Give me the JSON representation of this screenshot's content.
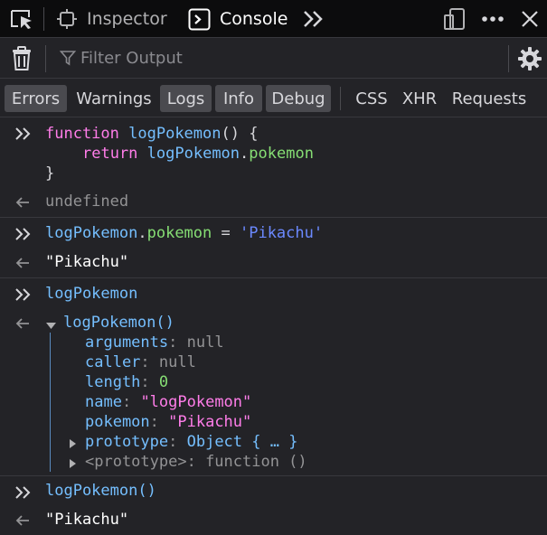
{
  "toolbar": {
    "tabs": [
      {
        "icon": "picker-icon"
      },
      {
        "label": "Inspector",
        "icon": "inspector-icon"
      },
      {
        "label": "Console",
        "icon": "console-icon"
      }
    ],
    "more_tools_icon": "double-chevron-icon",
    "right_icons": [
      "responsive-design-icon",
      "meatball-menu-icon",
      "close-icon"
    ]
  },
  "filter": {
    "placeholder": "Filter Output",
    "trash_icon": "trash-icon",
    "settings_icon": "gear-icon"
  },
  "categories": [
    {
      "label": "Errors",
      "active": true
    },
    {
      "label": "Warnings",
      "active": false
    },
    {
      "label": "Logs",
      "active": true
    },
    {
      "label": "Info",
      "active": true
    },
    {
      "label": "Debug",
      "active": true
    },
    {
      "label": "CSS",
      "active": false
    },
    {
      "label": "XHR",
      "active": false
    },
    {
      "label": "Requests",
      "active": false
    }
  ],
  "console": {
    "entry1": {
      "kw_function": "function",
      "fn_name": "logPokemon",
      "sig_rest": "() {",
      "kw_return": "return",
      "ret_obj": "logPokemon",
      "dot": ".",
      "ret_prop": "pokemon",
      "close_brace": "}",
      "result": "undefined"
    },
    "entry2": {
      "obj": "logPokemon",
      "dot": ".",
      "prop": "pokemon",
      "op": " = ",
      "value": "'Pikachu'",
      "result": "\"Pikachu\""
    },
    "entry3": {
      "input": "logPokemon",
      "tree_root": "logPokemon()",
      "props": [
        {
          "key": "arguments",
          "sep": ": ",
          "value": "null",
          "kind": "null"
        },
        {
          "key": "caller",
          "sep": ": ",
          "value": "null",
          "kind": "null"
        },
        {
          "key": "length",
          "sep": ": ",
          "value": "0",
          "kind": "number"
        },
        {
          "key": "name",
          "sep": ": ",
          "value": "\"logPokemon\"",
          "kind": "string"
        },
        {
          "key": "pokemon",
          "sep": ": ",
          "value": "\"Pikachu\"",
          "kind": "string"
        }
      ],
      "prototype_key": "prototype",
      "prototype_sep": ": ",
      "prototype_value": "Object { … }",
      "proto_internal_key": "<prototype>",
      "proto_internal_value": ": function ()"
    },
    "entry4": {
      "input": "logPokemon()",
      "result": "\"Pikachu\""
    }
  },
  "colors": {
    "background": "#232327",
    "toolbar": "#0c0c0d",
    "keyword": "#ff7de9",
    "function": "#75bfff",
    "property": "#86de74",
    "string_literal": "#6b89ff"
  }
}
